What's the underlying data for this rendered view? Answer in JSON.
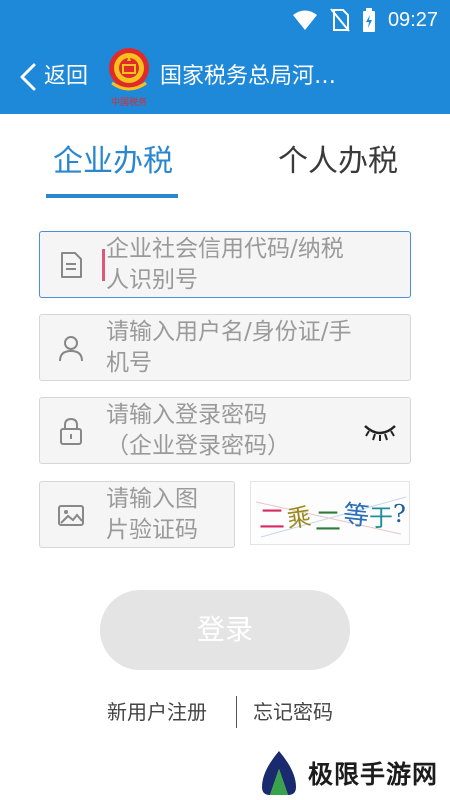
{
  "status_bar": {
    "time": "09:27",
    "icons": [
      "wifi-icon",
      "no-sim-icon",
      "battery-icon"
    ]
  },
  "app_bar": {
    "back_label": "返回",
    "title": "国家税务总局河…",
    "emblem_caption": "中国税务"
  },
  "tabs": [
    {
      "label": "企业办税",
      "selected": true
    },
    {
      "label": "个人办税",
      "selected": false
    }
  ],
  "form": {
    "username_placeholder_lines": [
      "企业社会信用代码/纳税",
      "人识别号"
    ],
    "userid_placeholder_lines": [
      "请输入用户名/身份证/手",
      "机号"
    ],
    "password_placeholder_lines": [
      "请输入登录密码",
      "（企业登录密码）"
    ],
    "captcha_placeholder_lines": [
      "请输入图",
      "片验证码"
    ],
    "captcha_text": "二乘二等于?",
    "login_label": "登录"
  },
  "links": {
    "register": "新用户注册",
    "forgot": "忘记密码"
  },
  "watermark": {
    "text": "极限手游网"
  },
  "colors": {
    "primary": "#1e88d9",
    "tab_active": "#2a87cf",
    "caret": "#e0557a",
    "button_disabled": "#e4e4e4"
  }
}
